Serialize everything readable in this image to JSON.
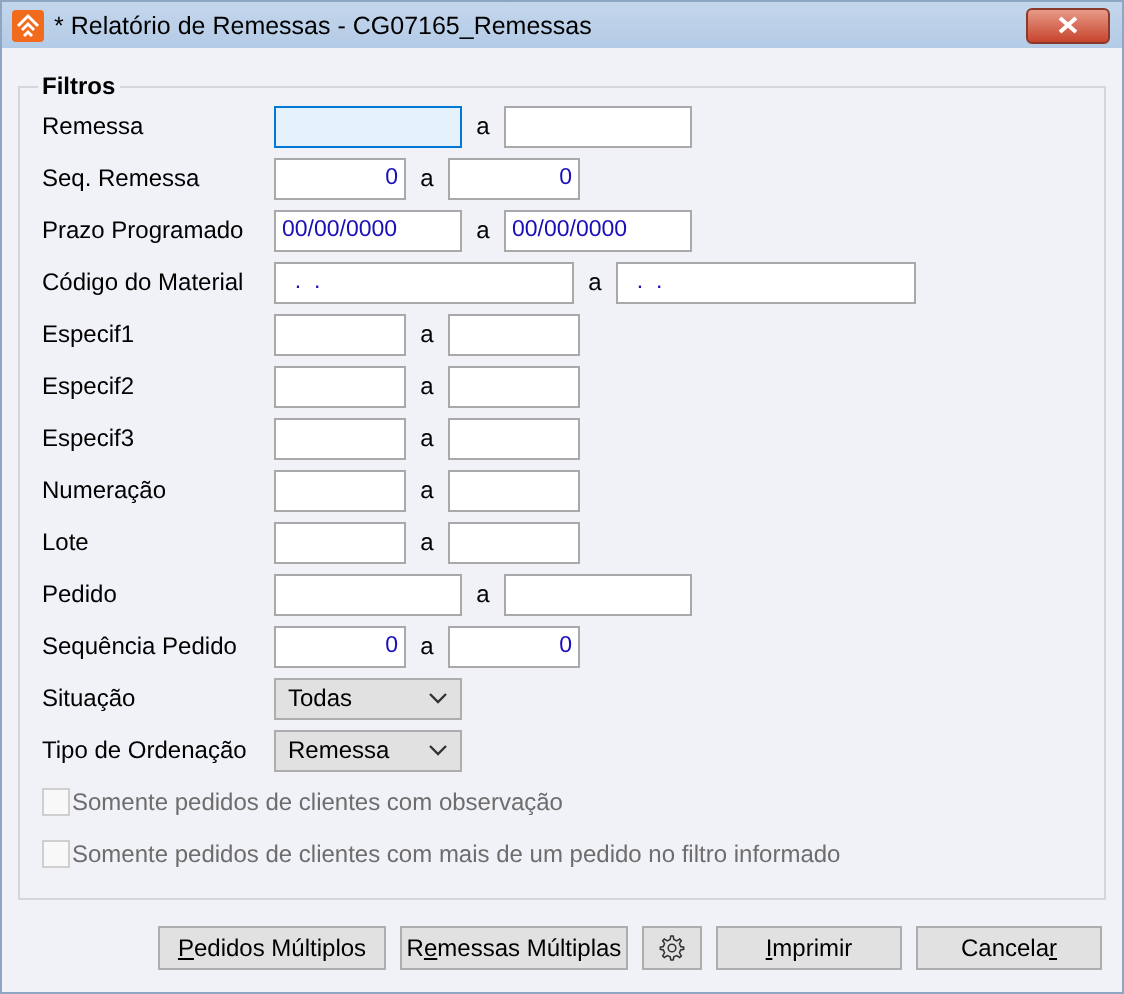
{
  "window": {
    "title": "* Relatório de Remessas - CG07165_Remessas"
  },
  "group": {
    "title": "Filtros"
  },
  "rows": [
    {
      "kind": "range",
      "label": "Remessa",
      "from": {
        "kind": "text",
        "focused": true
      },
      "separator": "a",
      "to": {
        "kind": "text",
        "focused": false
      }
    },
    {
      "kind": "range",
      "label": "Seq. Remessa",
      "from": {
        "kind": "number",
        "value": "0",
        "focused": false
      },
      "separator": "a",
      "to": {
        "kind": "number",
        "value": "0",
        "focused": false
      }
    },
    {
      "kind": "range",
      "label": "Prazo Programado",
      "from": {
        "kind": "text",
        "value": "00/00/0000",
        "focused": false
      },
      "separator": "a",
      "to": {
        "kind": "text",
        "value": "00/00/0000",
        "focused": false
      }
    },
    {
      "kind": "range",
      "label": "Código do Material",
      "from": {
        "kind": "text",
        "value": "  .  .",
        "focused": false
      },
      "separator": "a",
      "to": {
        "kind": "text",
        "value": "  .  .",
        "focused": false
      }
    },
    {
      "kind": "range",
      "label": "Especif1",
      "from": {
        "kind": "text",
        "focused": false
      },
      "separator": "a",
      "to": {
        "kind": "text",
        "focused": false
      }
    },
    {
      "kind": "range",
      "label": "Especif2",
      "from": {
        "kind": "text",
        "focused": false
      },
      "separator": "a",
      "to": {
        "kind": "text",
        "focused": false
      }
    },
    {
      "kind": "range",
      "label": "Especif3",
      "from": {
        "kind": "text",
        "focused": false
      },
      "separator": "a",
      "to": {
        "kind": "text",
        "focused": false
      }
    },
    {
      "kind": "range",
      "label": "Numeração",
      "from": {
        "kind": "text",
        "focused": false
      },
      "separator": "a",
      "to": {
        "kind": "text",
        "focused": false
      }
    },
    {
      "kind": "range",
      "label": "Lote",
      "from": {
        "kind": "text",
        "focused": false
      },
      "separator": "a",
      "to": {
        "kind": "text",
        "focused": false
      }
    },
    {
      "kind": "range",
      "label": "Pedido",
      "from": {
        "kind": "text",
        "focused": false
      },
      "separator": "a",
      "to": {
        "kind": "text",
        "focused": false
      }
    },
    {
      "kind": "range",
      "label": "Sequência Pedido",
      "from": {
        "kind": "number",
        "value": "0",
        "focused": false
      },
      "separator": "a",
      "to": {
        "kind": "number",
        "value": "0",
        "focused": false
      }
    },
    {
      "kind": "select",
      "label": "Situação",
      "value": "Todas"
    },
    {
      "kind": "select",
      "label": "Tipo de Ordenação",
      "value": "Remessa"
    }
  ],
  "checkboxes": [
    {
      "label": "Somente pedidos de clientes com observação",
      "checked": false,
      "disabled": true
    },
    {
      "label": "Somente pedidos de clientes com mais de um pedido no filtro informado",
      "checked": false,
      "disabled": true
    }
  ],
  "buttons": [
    {
      "kind": "text",
      "key": "P",
      "after": "edidos Múltiplos"
    },
    {
      "kind": "text",
      "before": "R",
      "key": "e",
      "after": "messas Múltiplas"
    },
    {
      "kind": "settings"
    },
    {
      "kind": "text",
      "key": "I",
      "after": "mprimir"
    },
    {
      "kind": "text",
      "before": "Cancela",
      "key": "r"
    }
  ]
}
